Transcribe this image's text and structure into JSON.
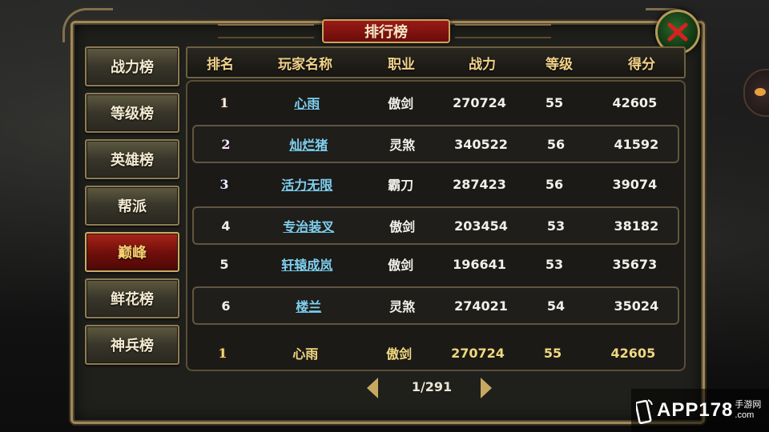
{
  "window": {
    "title": "排行榜"
  },
  "sidebar": {
    "items": [
      {
        "label": "战力榜",
        "active": false
      },
      {
        "label": "等级榜",
        "active": false
      },
      {
        "label": "英雄榜",
        "active": false
      },
      {
        "label": "帮派",
        "active": false
      },
      {
        "label": "巅峰",
        "active": true
      },
      {
        "label": "鲜花榜",
        "active": false
      },
      {
        "label": "神兵榜",
        "active": false
      }
    ]
  },
  "table": {
    "headers": {
      "rank": "排名",
      "name": "玩家名称",
      "job": "职业",
      "power": "战力",
      "level": "等级",
      "score": "得分"
    },
    "rows": [
      {
        "rank": "1",
        "name": "心雨",
        "job": "傲剑",
        "power": "270724",
        "level": "55",
        "score": "42605"
      },
      {
        "rank": "2",
        "name": "灿烂猪",
        "job": "灵煞",
        "power": "340522",
        "level": "56",
        "score": "41592"
      },
      {
        "rank": "3",
        "name": "活力无限",
        "job": "霸刀",
        "power": "287423",
        "level": "56",
        "score": "39074"
      },
      {
        "rank": "4",
        "name": "专治装叉",
        "job": "傲剑",
        "power": "203454",
        "level": "53",
        "score": "38182"
      },
      {
        "rank": "5",
        "name": "轩辕成岚",
        "job": "傲剑",
        "power": "196641",
        "level": "53",
        "score": "35673"
      },
      {
        "rank": "6",
        "name": "楼兰",
        "job": "灵煞",
        "power": "274021",
        "level": "54",
        "score": "35024"
      }
    ],
    "self": {
      "rank": "1",
      "name": "心雨",
      "job": "傲剑",
      "power": "270724",
      "level": "55",
      "score": "42605"
    }
  },
  "pager": {
    "page": "1/291"
  },
  "watermark": {
    "brand": "APP178",
    "sub1": "手游网",
    "sub2": ".com"
  },
  "colors": {
    "gold_border": "#a08858",
    "active_tab": "#a82418",
    "rank1": "#f0a030",
    "rank2": "#b45ad8",
    "rank3": "#4a64e8",
    "name_link": "#7fd0f0",
    "self_text": "#f0d880"
  },
  "icons": {
    "close": "close-x-icon",
    "prev": "arrow-left-icon",
    "next": "arrow-right-icon"
  }
}
